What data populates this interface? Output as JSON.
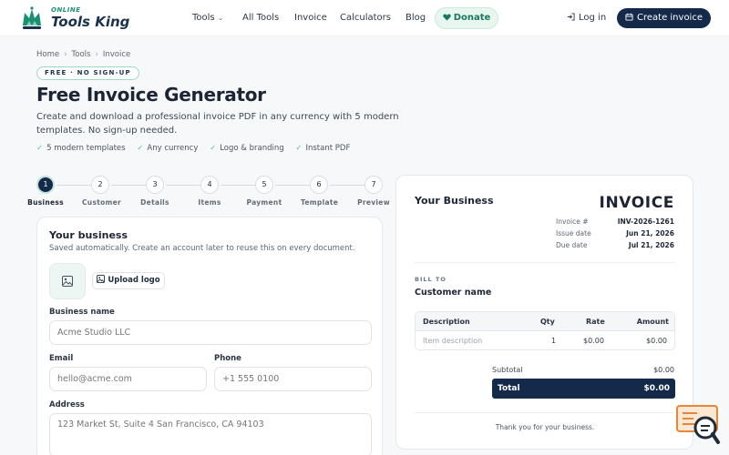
{
  "brand": {
    "top": "ONLINE",
    "name": "Tools King"
  },
  "nav": {
    "tools": "Tools",
    "all_tools": "All Tools",
    "invoice": "Invoice",
    "calculators": "Calculators",
    "blog": "Blog",
    "donate": "Donate",
    "login": "Log in",
    "create_invoice": "Create invoice"
  },
  "breadcrumb": [
    "Home",
    "Tools",
    "Invoice"
  ],
  "hero": {
    "badge": "FREE · NO SIGN-UP",
    "title": "Free Invoice Generator",
    "subtitle": "Create and download a professional invoice PDF in any currency with 5 modern templates. No sign-up needed.",
    "features": [
      "5 modern templates",
      "Any currency",
      "Logo & branding",
      "Instant PDF"
    ]
  },
  "steps": [
    {
      "num": "1",
      "label": "Business"
    },
    {
      "num": "2",
      "label": "Customer"
    },
    {
      "num": "3",
      "label": "Details"
    },
    {
      "num": "4",
      "label": "Items"
    },
    {
      "num": "5",
      "label": "Payment"
    },
    {
      "num": "6",
      "label": "Template"
    },
    {
      "num": "7",
      "label": "Preview"
    }
  ],
  "form": {
    "title": "Your business",
    "subtitle": "Saved automatically. Create an account later to reuse this on every document.",
    "upload_logo": "Upload logo",
    "business_name_label": "Business name",
    "business_name_placeholder": "Acme Studio LLC",
    "email_label": "Email",
    "email_placeholder": "hello@acme.com",
    "phone_label": "Phone",
    "phone_placeholder": "+1 555 0100",
    "address_label": "Address",
    "address_placeholder": "123 Market St, Suite 4 San Francisco, CA 94103"
  },
  "preview": {
    "business": "Your Business",
    "heading": "INVOICE",
    "invoice_no_label": "Invoice #",
    "invoice_no": "INV-2026-1261",
    "issue_label": "Issue date",
    "issue_date": "Jun 21, 2026",
    "due_label": "Due date",
    "due_date": "Jul 21, 2026",
    "bill_to": "BILL TO",
    "customer": "Customer name",
    "columns": {
      "description": "Description",
      "qty": "Qty",
      "rate": "Rate",
      "amount": "Amount"
    },
    "item": {
      "description": "Item description",
      "qty": "1",
      "rate": "$0.00",
      "amount": "$0.00"
    },
    "subtotal_label": "Subtotal",
    "subtotal": "$0.00",
    "total_label": "Total",
    "total": "$0.00",
    "thanks": "Thank you for your business."
  },
  "colors": {
    "navy": "#15294a",
    "accent": "#1a8f73",
    "accent_light": "#e8f6f0"
  }
}
